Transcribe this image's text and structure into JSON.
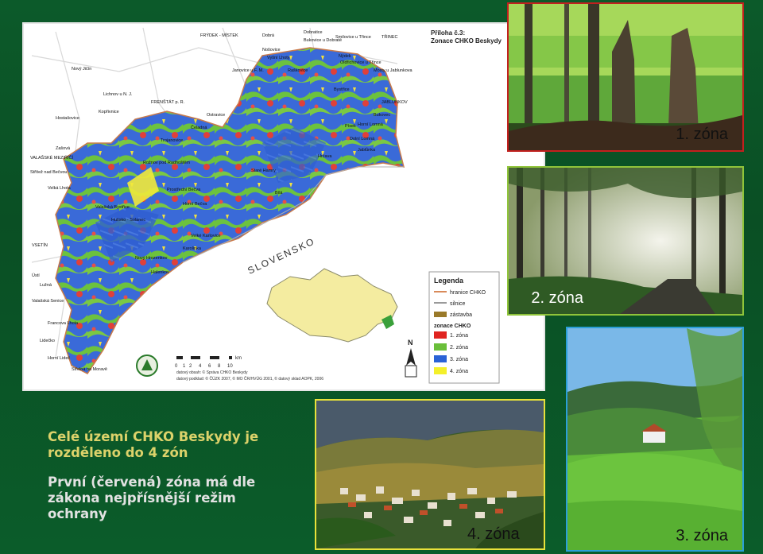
{
  "map": {
    "appendix_line1": "Příloha č.3:",
    "appendix_line2": "Zonace CHKO Beskydy",
    "country_label": "SLOVENSKO",
    "scale_label": "km",
    "scale_ticks": [
      "0",
      "1",
      "2",
      "4",
      "6",
      "8",
      "10"
    ],
    "credits": [
      "datový obsah: © Správa CHKO Beskydy",
      "datový podklad: © ČÚZK 2007, © MO ČR/HVÚG 2001, © datový sklad AOPK, 2006"
    ],
    "north_label": "N",
    "places": [
      "FRÝDEK - MÍSTEK",
      "Dobrá",
      "Nošovice",
      "Dobratice",
      "Bukovice u Dobraté",
      "Smilovice u Třince",
      "TŘINEC",
      "Vyšní Lhoty",
      "Nýdek",
      "Oldřichovice u Třince",
      "Mosty u Jablunkova",
      "Janovice u F. M.",
      "Raškovice",
      "Nový Jičín",
      "Lichnov u N. J.",
      "FRENŠTÁT p. R.",
      "Hostašovice",
      "Kopřivnice",
      "Čeladná",
      "Ostravice",
      "Trojanovice",
      "Zašová",
      "VALAŠSKÉ MEZIŘÍČÍ",
      "Střítež nad Bečvou",
      "Velká Lhota",
      "Rožnov pod Radhoštěm",
      "Prostřední Bečva",
      "Horní Bečva",
      "Valašská Bystřice",
      "Hutisko - Solanec",
      "Velké Karlovice",
      "Karolinka",
      "Nový Hrozenkov",
      "Halenkov",
      "VSETÍN",
      "Ústí",
      "Lužná",
      "Valašská Senice",
      "Francova Lhota",
      "Lidečko",
      "Horní Lideč",
      "Střelná na Moravě",
      "JABLUNKOV",
      "Bukovec",
      "Bystřice",
      "Písek",
      "Hrčava",
      "Horní Lomná",
      "Dolní Lomná",
      "Staré Hamry",
      "Bílá",
      "Jablůnka"
    ]
  },
  "legend": {
    "title": "Legenda",
    "items": [
      {
        "label": "hranice CHKO",
        "color": "#d98a5a"
      },
      {
        "label": "silnice",
        "color": "#9a9a9a"
      },
      {
        "label": "zástavba",
        "color": "#9a7a2a"
      }
    ],
    "zones_title": "zonace CHKO",
    "zones": [
      {
        "label": "1. zóna",
        "color": "#e02420"
      },
      {
        "label": "2. zóna",
        "color": "#6abf3a"
      },
      {
        "label": "3. zóna",
        "color": "#2a62d6"
      },
      {
        "label": "4. zóna",
        "color": "#f4f02a"
      }
    ]
  },
  "photos": {
    "zone1": "1. zóna",
    "zone2": "2. zóna",
    "zone3": "3. zóna",
    "zone4": "4. zóna"
  },
  "caption": {
    "line1": "Celé území CHKO Beskydy je",
    "line2": "rozděleno do 4 zón",
    "line3": "První (červená) zóna má dle",
    "line4": "zákona nejpřísnější režim",
    "line5": "ochrany"
  }
}
